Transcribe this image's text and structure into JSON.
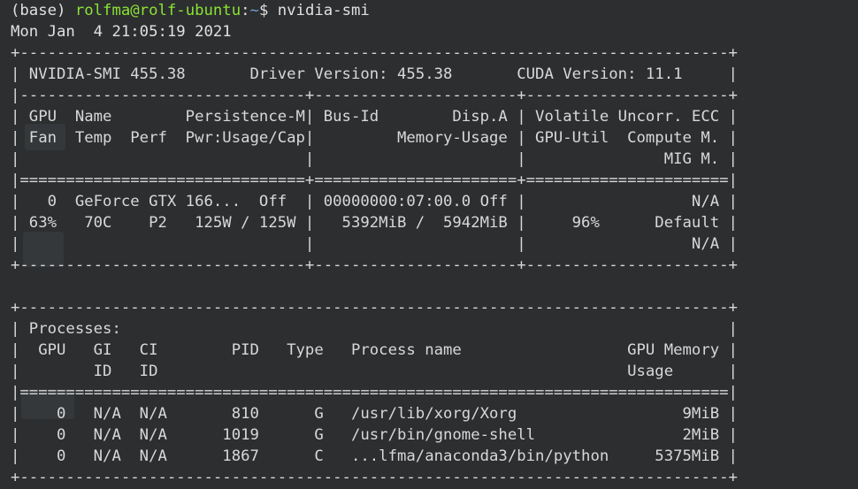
{
  "prompt": {
    "env": "(base)",
    "user_host": "rolfma@rolf-ubuntu",
    "separator": ":",
    "path": "~",
    "symbol": "$",
    "command": "nvidia-smi"
  },
  "timestamp": "Mon Jan  4 21:05:19 2021",
  "smi_output": [
    "+-----------------------------------------------------------------------------+",
    "| NVIDIA-SMI 455.38       Driver Version: 455.38       CUDA Version: 11.1     |",
    "|-------------------------------+----------------------+----------------------+",
    "| GPU  Name        Persistence-M| Bus-Id        Disp.A | Volatile Uncorr. ECC |",
    "| Fan  Temp  Perf  Pwr:Usage/Cap|         Memory-Usage | GPU-Util  Compute M. |",
    "|                               |                      |               MIG M. |",
    "|===============================+======================+======================|",
    "|   0  GeForce GTX 166...  Off  | 00000000:07:00.0 Off |                  N/A |",
    "| 63%   70C    P2   125W / 125W |   5392MiB /  5942MiB |     96%      Default |",
    "|                               |                      |                  N/A |",
    "+-------------------------------+----------------------+----------------------+",
    "",
    "+-----------------------------------------------------------------------------+",
    "| Processes:                                                                  |",
    "|  GPU   GI   CI        PID   Type   Process name                  GPU Memory |",
    "|        ID   ID                                                   Usage      |",
    "|=============================================================================|",
    "|    0   N/A  N/A       810      G   /usr/lib/xorg/Xorg                  9MiB |",
    "|    0   N/A  N/A      1019      G   /usr/bin/gnome-shell                2MiB |",
    "|    0   N/A  N/A      1867      C   ...lfma/anaconda3/bin/python     5375MiB |",
    "+-----------------------------------------------------------------------------+"
  ],
  "colors": {
    "background": "#2c2e30",
    "text": "#e0e0e0",
    "user_host": "#8ae234",
    "path": "#729fcf"
  }
}
